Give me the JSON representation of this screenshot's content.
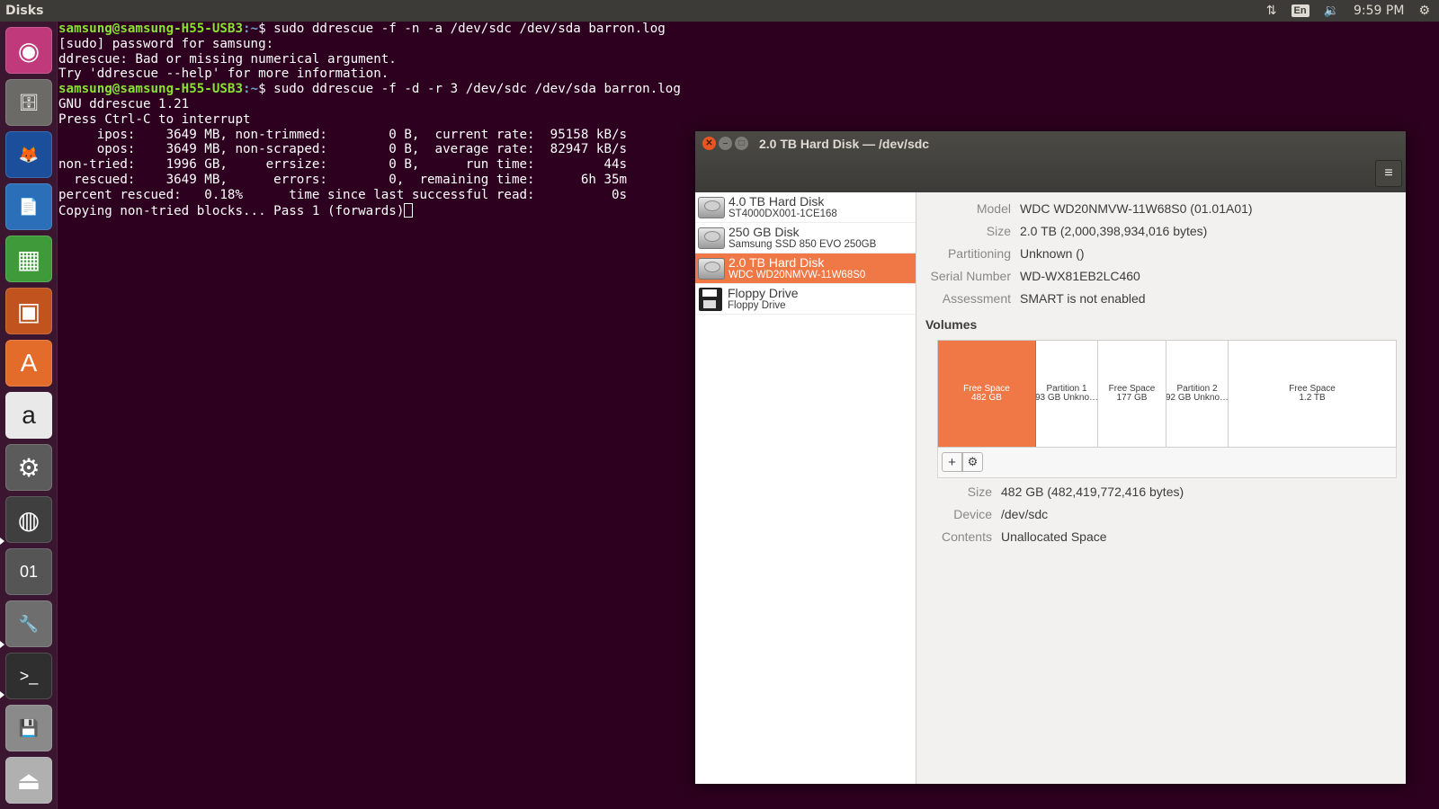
{
  "top_panel": {
    "app_title": "Disks",
    "network_icon": "⇅",
    "keyboard": "En",
    "volume_icon": "🔉",
    "clock": "9:59 PM",
    "settings_icon": "⚙"
  },
  "launcher": {
    "items": [
      {
        "name": "ubuntu-dash",
        "glyph": "◉",
        "color": "#c0397a"
      },
      {
        "name": "files",
        "glyph": "🗄",
        "color": "#6b6a66"
      },
      {
        "name": "firefox",
        "glyph": "🦊",
        "color": "#1b4f9c"
      },
      {
        "name": "libreoffice-writer",
        "glyph": "📄",
        "color": "#2a6fb7"
      },
      {
        "name": "libreoffice-calc",
        "glyph": "▦",
        "color": "#3f9b3a"
      },
      {
        "name": "libreoffice-impress",
        "glyph": "▣",
        "color": "#c0531e"
      },
      {
        "name": "software-center",
        "glyph": "A",
        "color": "#e46c2a"
      },
      {
        "name": "amazon",
        "glyph": "a",
        "color": "#e9e9e9"
      },
      {
        "name": "system-settings",
        "glyph": "⚙",
        "color": "#5b5b5b"
      },
      {
        "name": "chrome",
        "glyph": "◍",
        "color": "#3f3f3f"
      },
      {
        "name": "hex-editor",
        "glyph": "01",
        "color": "#555"
      },
      {
        "name": "disks-tool",
        "glyph": "🔧",
        "color": "#6e6e6e"
      },
      {
        "name": "terminal",
        "glyph": ">_",
        "color": "#2f2f2f"
      },
      {
        "name": "save-drive",
        "glyph": "💾",
        "color": "#8a8a8a"
      },
      {
        "name": "removable-drive",
        "glyph": "⏏",
        "color": "#b0b0b0"
      }
    ]
  },
  "terminal": {
    "lines": [
      {
        "user": "samsung@samsung-H55-USB3",
        "path": ":~",
        "cmd": "$ sudo ddrescue -f -n -a /dev/sdc /dev/sda barron.log"
      },
      {
        "text": "[sudo] password for samsung:"
      },
      {
        "text": "ddrescue: Bad or missing numerical argument."
      },
      {
        "text": "Try 'ddrescue --help' for more information."
      },
      {
        "user": "samsung@samsung-H55-USB3",
        "path": ":~",
        "cmd": "$ sudo ddrescue -f -d -r 3 /dev/sdc /dev/sda barron.log"
      },
      {
        "text": "GNU ddrescue 1.21"
      },
      {
        "text": "Press Ctrl-C to interrupt"
      },
      {
        "text": "     ipos:    3649 MB, non-trimmed:        0 B,  current rate:  95158 kB/s"
      },
      {
        "text": "     opos:    3649 MB, non-scraped:        0 B,  average rate:  82947 kB/s"
      },
      {
        "text": "non-tried:    1996 GB,     errsize:        0 B,      run time:         44s"
      },
      {
        "text": "  rescued:    3649 MB,      errors:        0,  remaining time:      6h 35m"
      },
      {
        "text": "percent rescued:   0.18%      time since last successful read:          0s"
      },
      {
        "text": "Copying non-tried blocks... Pass 1 (forwards)",
        "cursor": true
      }
    ]
  },
  "disks_window": {
    "title": "2.0 TB Hard Disk — /dev/sdc",
    "close_glyph": "✕",
    "min_glyph": "–",
    "max_glyph": "□",
    "menu_glyph": "≡",
    "disks": [
      {
        "name": "4.0 TB Hard Disk",
        "sub": "ST4000DX001-1CE168",
        "type": "hdd",
        "selected": false
      },
      {
        "name": "250 GB Disk",
        "sub": "Samsung SSD 850 EVO 250GB",
        "type": "hdd",
        "selected": false
      },
      {
        "name": "2.0 TB Hard Disk",
        "sub": "WDC WD20NMVW-11W68S0",
        "type": "hdd",
        "selected": true
      },
      {
        "name": "Floppy Drive",
        "sub": "Floppy Drive",
        "type": "floppy",
        "selected": false
      }
    ],
    "info": {
      "model_label": "Model",
      "model": "WDC WD20NMVW-11W68S0 (01.01A01)",
      "size_label": "Size",
      "size": "2.0 TB (2,000,398,934,016 bytes)",
      "partitioning_label": "Partitioning",
      "partitioning": "Unknown ()",
      "serial_label": "Serial Number",
      "serial": "WD-WX81EB2LC460",
      "assessment_label": "Assessment",
      "assessment": "SMART is not enabled"
    },
    "volumes_title": "Volumes",
    "volumes": [
      {
        "line1": "Free Space",
        "line2": "482 GB",
        "share": 0.215,
        "selected": true
      },
      {
        "line1": "Partition 1",
        "line2": "93 GB Unkno…",
        "share": 0.135,
        "selected": false
      },
      {
        "line1": "Free Space",
        "line2": "177 GB",
        "share": 0.15,
        "selected": false
      },
      {
        "line1": "Partition 2",
        "line2": "92 GB Unkno…",
        "share": 0.135,
        "selected": false
      },
      {
        "line1": "Free Space",
        "line2": "1.2 TB",
        "share": 0.365,
        "selected": false
      }
    ],
    "tools": {
      "add_glyph": "+",
      "settings_glyph": "⚙"
    },
    "volume_info": {
      "size_label": "Size",
      "size": "482 GB (482,419,772,416 bytes)",
      "device_label": "Device",
      "device": "/dev/sdc",
      "contents_label": "Contents",
      "contents": "Unallocated Space"
    }
  }
}
